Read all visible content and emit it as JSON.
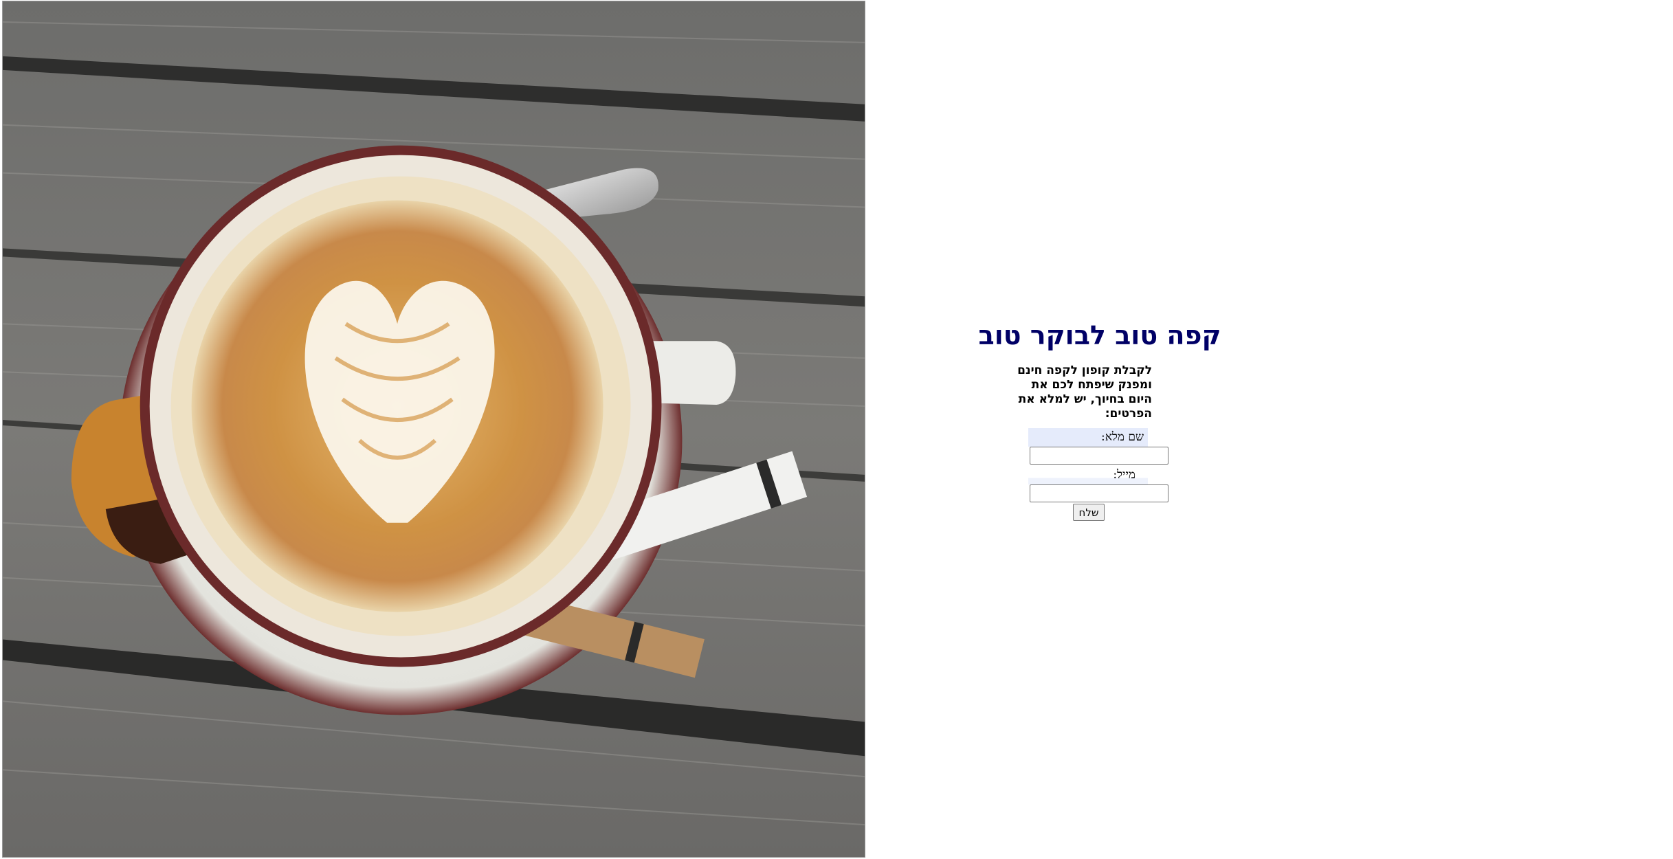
{
  "hero_image": {
    "subject": "latte art coffee cup on wooden table with cookie, spoon and sugar sticks"
  },
  "form": {
    "title": "קפה טוב לבוקר טוב",
    "intro": "לקבלת קופון לקפה חינם ומפנק שיפתח לכם את היום בחיוך, יש למלא את הפרטים:",
    "name_label": "שם מלא:",
    "email_label": "מייל:",
    "name_value": "",
    "email_value": "",
    "submit_label": "שלח"
  },
  "colors": {
    "title": "#000066",
    "label_highlight": "#e5ebfb"
  }
}
